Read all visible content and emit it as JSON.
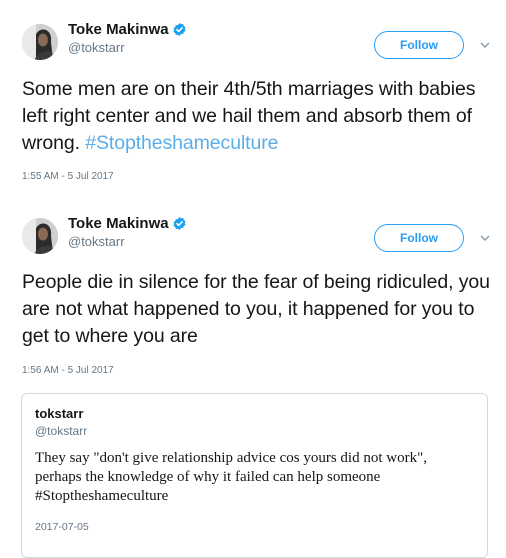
{
  "tweets": [
    {
      "author": {
        "name": "Toke Makinwa",
        "handle": "@tokstarr",
        "verified": true
      },
      "follow_label": "Follow",
      "text": "Some men are on their 4th/5th marriages with babies left right center and we hail them and absorb them of wrong. ",
      "hashtag": "#Stoptheshameculture",
      "timestamp": "1:55 AM - 5 Jul 2017"
    },
    {
      "author": {
        "name": "Toke Makinwa",
        "handle": "@tokstarr",
        "verified": true
      },
      "follow_label": "Follow",
      "text": "People die in silence for the fear of being ridiculed, you are not what happened to you, it happened for you to get to where you are",
      "timestamp": "1:56 AM - 5 Jul 2017",
      "quote": {
        "username": "tokstarr",
        "handle": "@tokstarr",
        "text": "They say \"don't give relationship advice cos yours did not work\", perhaps the knowledge of why it failed can help someone #Stoptheshameculture",
        "date": "2017-07-05"
      }
    }
  ],
  "icons": {
    "verified": "verified-badge-icon",
    "caret": "chevron-down-icon",
    "avatar": "profile-photo"
  },
  "colors": {
    "link": "#5aaee8",
    "follow_border": "#2a9df4",
    "secondary_text": "#657786",
    "verified_badge": "#1da1f2"
  }
}
